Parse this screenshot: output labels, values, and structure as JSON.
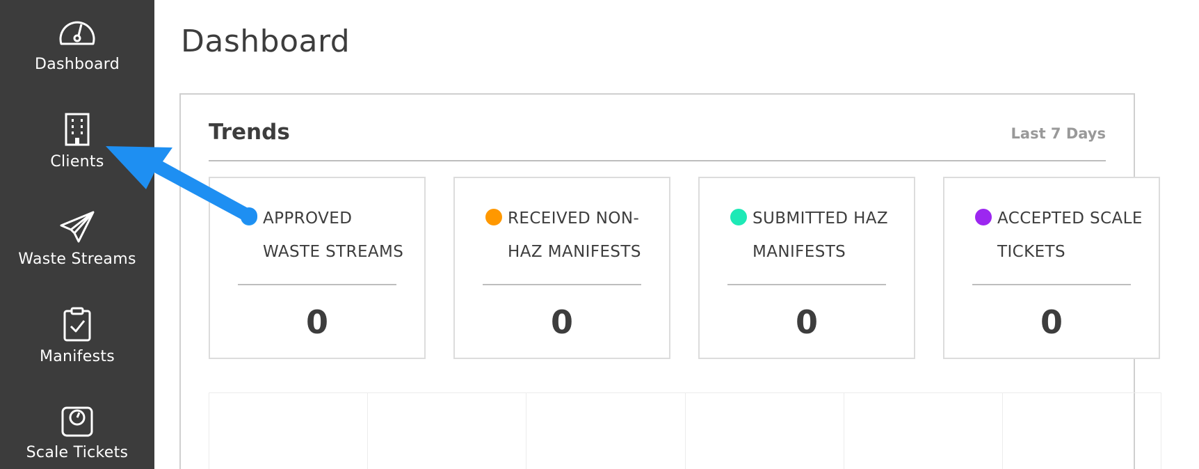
{
  "sidebar": {
    "items": [
      {
        "label": "Dashboard",
        "icon": "speedometer-icon"
      },
      {
        "label": "Clients",
        "icon": "building-icon"
      },
      {
        "label": "Waste Streams",
        "icon": "paper-plane-icon"
      },
      {
        "label": "Manifests",
        "icon": "clipboard-check-icon"
      },
      {
        "label": "Scale Tickets",
        "icon": "scale-icon"
      }
    ]
  },
  "page": {
    "title": "Dashboard"
  },
  "trends": {
    "title": "Trends",
    "range": "Last 7 Days",
    "cards": [
      {
        "label": "Approved Waste Streams",
        "value": "0",
        "color": "#2196F3"
      },
      {
        "label": "Received Non-Haz Manifests",
        "value": "0",
        "color": "#FF9800"
      },
      {
        "label": "Submitted Haz Manifests",
        "value": "0",
        "color": "#1DE9B6"
      },
      {
        "label": "Accepted Scale Tickets",
        "value": "0",
        "color": "#9C27F0"
      }
    ]
  },
  "colors": {
    "sidebar_bg": "#3c3c3c",
    "annotation_arrow": "#1e8ff2"
  }
}
